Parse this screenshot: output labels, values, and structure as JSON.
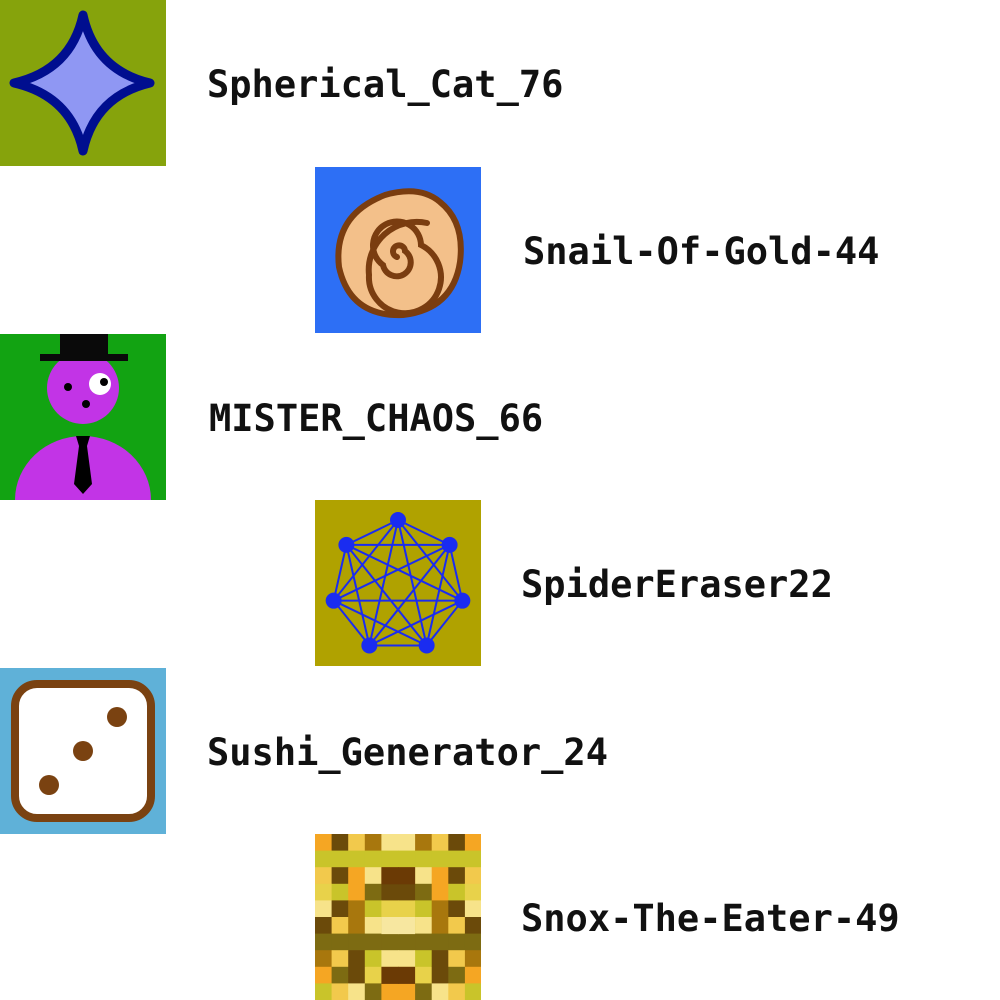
{
  "users": [
    {
      "username": "Spherical_Cat_76",
      "avatar_icon": "four-point-star-icon",
      "avatar_bg": "#86a30c"
    },
    {
      "username": "Snail-Of-Gold-44",
      "avatar_icon": "snail-shell-spiral-icon",
      "avatar_bg": "#2d6ff5"
    },
    {
      "username": "MISTER_CHAOS_66",
      "avatar_icon": "top-hat-gentleman-icon",
      "avatar_bg": "#12a312"
    },
    {
      "username": "SpiderEraser22",
      "avatar_icon": "heptagon-web-icon",
      "avatar_bg": "#b0a200"
    },
    {
      "username": "Sushi_Generator_24",
      "avatar_icon": "die-three-pips-icon",
      "avatar_bg": "#5fb1d8"
    },
    {
      "username": "Snox-The-Eater-49",
      "avatar_icon": "pixel-pattern-icon",
      "avatar_bg": "#d4b21a"
    }
  ]
}
